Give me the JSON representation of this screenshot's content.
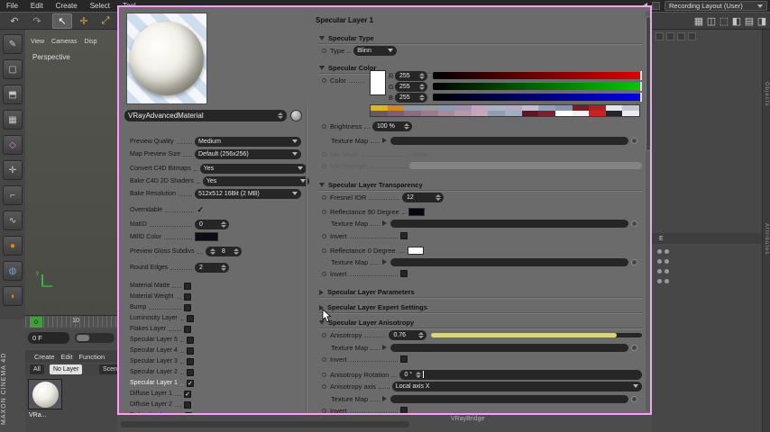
{
  "menubar": {
    "items": [
      "File",
      "Edit",
      "Create",
      "Select",
      "Tool"
    ],
    "layout_selector": "Recording Layout (User)"
  },
  "viewport": {
    "menu_items": [
      "View",
      "Cameras",
      "Disp"
    ],
    "camera_label": "Perspective",
    "axis_label": "y"
  },
  "timeline": {
    "current_frame": "0",
    "tick_label": "10",
    "frame_value": "0 F"
  },
  "material_manager": {
    "menu_items": [
      "Create",
      "Edit",
      "Function"
    ],
    "filters": [
      "All",
      "No Layer",
      "Scen"
    ],
    "material_label": "VRa..."
  },
  "status_bar": {
    "text": "VRayBridge"
  },
  "branding": {
    "text": "MAXON CINEMA 4D"
  },
  "objects_panel": {
    "column_header": "E"
  },
  "side_tabs": {
    "tab1": "Objects",
    "tab2": "Attributes"
  },
  "material_editor": {
    "name": "VRayAdvancedMaterial",
    "panel_title": "Specular Layer 1",
    "basic": {
      "preview_quality": {
        "label": "Preview Quality",
        "value": "Medium"
      },
      "map_preview_size": {
        "label": "Map Preview Size",
        "value": "Default (256x256)"
      },
      "convert_bitmaps": {
        "label": "Convert C4D Bitmaps",
        "value": "Yes"
      },
      "bake_shaders": {
        "label": "Bake C4D 2D Shaders",
        "value": "Yes"
      },
      "bake_resolution": {
        "label": "Bake Resolution",
        "value": "512x512  16Bit  (2 MB)"
      },
      "overridable": {
        "label": "Overridable",
        "check": "✓"
      },
      "matid": {
        "label": "MatID",
        "value": "0"
      },
      "mtlid_color": {
        "label": "MtlID Color",
        "color": "#0c0c14"
      },
      "gloss_subdivs": {
        "label": "Preview Gloss Subdivs",
        "value": "8"
      },
      "round_edges": {
        "label": "Round Edges",
        "value": "2"
      }
    },
    "layers": [
      {
        "label": "Material Matte",
        "check": ""
      },
      {
        "label": "Material Weight",
        "check": ""
      },
      {
        "label": "Bump",
        "check": ""
      },
      {
        "label": "Luminosity Layer",
        "check": ""
      },
      {
        "label": "Flakes Layer",
        "check": ""
      },
      {
        "label": "Specular Layer 5",
        "check": ""
      },
      {
        "label": "Specular Layer 4",
        "check": ""
      },
      {
        "label": "Specular Layer 3",
        "check": ""
      },
      {
        "label": "Specular Layer 2",
        "check": ""
      },
      {
        "label": "Specular Layer 1",
        "check": "✓"
      },
      {
        "label": "Diffuse Layer 1",
        "check": "✓"
      },
      {
        "label": "Diffuse Layer 2",
        "check": ""
      },
      {
        "label": "Refraction Layer",
        "check": ""
      }
    ],
    "specular_type": {
      "header": "Specular Type",
      "type_label": "Type",
      "type_value": "Blinn"
    },
    "specular_color": {
      "header": "Specular Color",
      "color_label": "Color",
      "channels": [
        {
          "label": "R",
          "value": "255"
        },
        {
          "label": "G",
          "value": "255"
        },
        {
          "label": "B",
          "value": "255"
        }
      ],
      "palette_row1": [
        "#e0b41e",
        "#d5871f",
        "#8c96a4",
        "#97959e",
        "#8e9bb2",
        "#a295b1",
        "#c2a5bf",
        "#a9b3c6",
        "#b3abc1",
        "#c5bccf",
        "#94a1b9",
        "#8693a9",
        "#7a1c21",
        "#ad2026",
        "#e6e6ed",
        "#c4c4cd"
      ],
      "palette_row2": [
        "#6a5964",
        "#7b6071",
        "#8b6b7f",
        "#9a7a8d",
        "#a9899c",
        "#b797aa",
        "#c6a7b9",
        "#8f9fb1",
        "#9fafc1",
        "#5e1627",
        "#7e1f2f",
        "#fefefe",
        "#f1f1f5",
        "#ce2121",
        "#24242c",
        "#ebebf3"
      ],
      "brightness_label": "Brightness",
      "brightness_value": "100 %",
      "texture_map_label": "Texture Map",
      "mix_mode_label": "Mix Mode",
      "mix_mode_value": "None",
      "mix_strength_label": "Mix Strength"
    },
    "transparency": {
      "header": "Specular Layer Transparency",
      "fresnel_label": "Fresnel IOR",
      "fresnel_value": "12",
      "refl90_label": "Reflectance 90 Degree",
      "refl90_color": "#05050e",
      "refl0_label": "Reflectance 0 Degree",
      "refl0_color": "#fcfcfc",
      "texture_map_label": "Texture Map",
      "invert_label": "Invert"
    },
    "parameters_header": "Specular Layer Parameters",
    "expert_header": "Specular Layer Expert Settings",
    "anisotropy": {
      "header": "Specular Layer Anisotropy",
      "anisotropy_label": "Anisotropy",
      "anisotropy_value": "0.76",
      "slider_width": "88%",
      "texture_map_label": "Texture Map",
      "invert_label": "Invert",
      "rotation_label": "Anisotropy Rotation",
      "rotation_value": "0 °",
      "axis_label": "Anisotropy axis",
      "axis_value": "Local axis X"
    }
  }
}
